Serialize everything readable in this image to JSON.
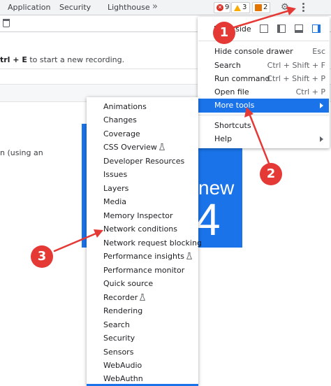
{
  "tabs": [
    "Application",
    "Security",
    "Lighthouse"
  ],
  "more_tabs_glyph": "»",
  "badges": {
    "errors": "9",
    "warnings": "3",
    "info": "2"
  },
  "toolbar": {
    "settings_icon": "gear-icon",
    "menu_icon": "kebab-menu-icon",
    "clear_icon": "trash-icon"
  },
  "recording_hint": {
    "keys": "trl + E",
    "text": " to start a new recording."
  },
  "partial_text": "n (using an",
  "promo": {
    "new": "new",
    "number": "4"
  },
  "main_menu": {
    "dock_label": "Dock side",
    "items": [
      {
        "label": "Hide console drawer",
        "shortcut": "Esc"
      },
      {
        "label": "Search",
        "shortcut": "Ctrl + Shift + F"
      },
      {
        "label": "Run command",
        "shortcut": "Ctrl + Shift + P"
      },
      {
        "label": "Open file",
        "shortcut": "Ctrl + P"
      },
      {
        "label": "More tools",
        "shortcut": ""
      },
      {
        "label": "Shortcuts",
        "shortcut": ""
      },
      {
        "label": "Help",
        "shortcut": ""
      }
    ]
  },
  "sub_menu": {
    "items": [
      "Animations",
      "Changes",
      "Coverage",
      "CSS Overview",
      "Developer Resources",
      "Issues",
      "Layers",
      "Media",
      "Memory Inspector",
      "Network conditions",
      "Network request blocking",
      "Performance insights",
      "Performance monitor",
      "Quick source",
      "Recorder",
      "Rendering",
      "Search",
      "Security",
      "Sensors",
      "WebAudio",
      "WebAuthn"
    ]
  },
  "callouts": [
    "1",
    "2",
    "3"
  ],
  "colors": {
    "accent": "#1a73e8",
    "callout": "#e53935",
    "error": "#d93025",
    "warning": "#f9ab00"
  }
}
